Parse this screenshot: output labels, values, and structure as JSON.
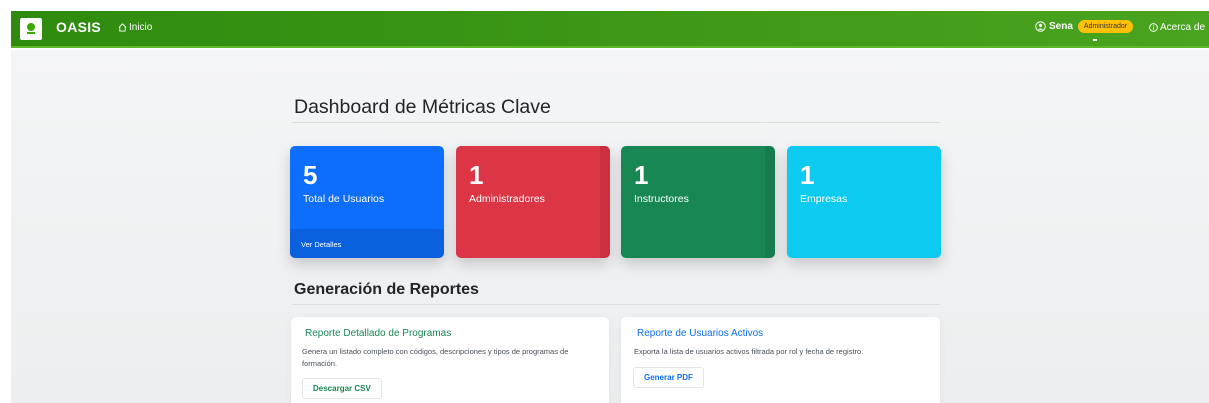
{
  "navbar": {
    "brand": "OASIS",
    "home_label": "Inicio",
    "user_name": "Sena",
    "role": "Administrador",
    "about_label": "Acerca de"
  },
  "dashboard": {
    "title": "Dashboard de Métricas Clave",
    "cards": [
      {
        "value": "5",
        "label": "Total de Usuarios",
        "footer": "Ver Detalles",
        "color": "#0d6efd"
      },
      {
        "value": "1",
        "label": "Administradores",
        "color": "#dc3545"
      },
      {
        "value": "1",
        "label": "Instructores",
        "color": "#198754"
      },
      {
        "value": "1",
        "label": "Empresas",
        "color": "#0dcaf0"
      }
    ]
  },
  "reports": {
    "title": "Generación de Reportes",
    "items": [
      {
        "title": "Reporte Detallado de Programas",
        "description": "Genera un listado completo con códigos, descripciones y tipos de programas de formación.",
        "button": "Descargar CSV"
      },
      {
        "title": "Reporte de Usuarios Activos",
        "description": "Exporta la lista de usuarios activos filtrada por rol y fecha de registro.",
        "button": "Generar PDF"
      }
    ]
  }
}
